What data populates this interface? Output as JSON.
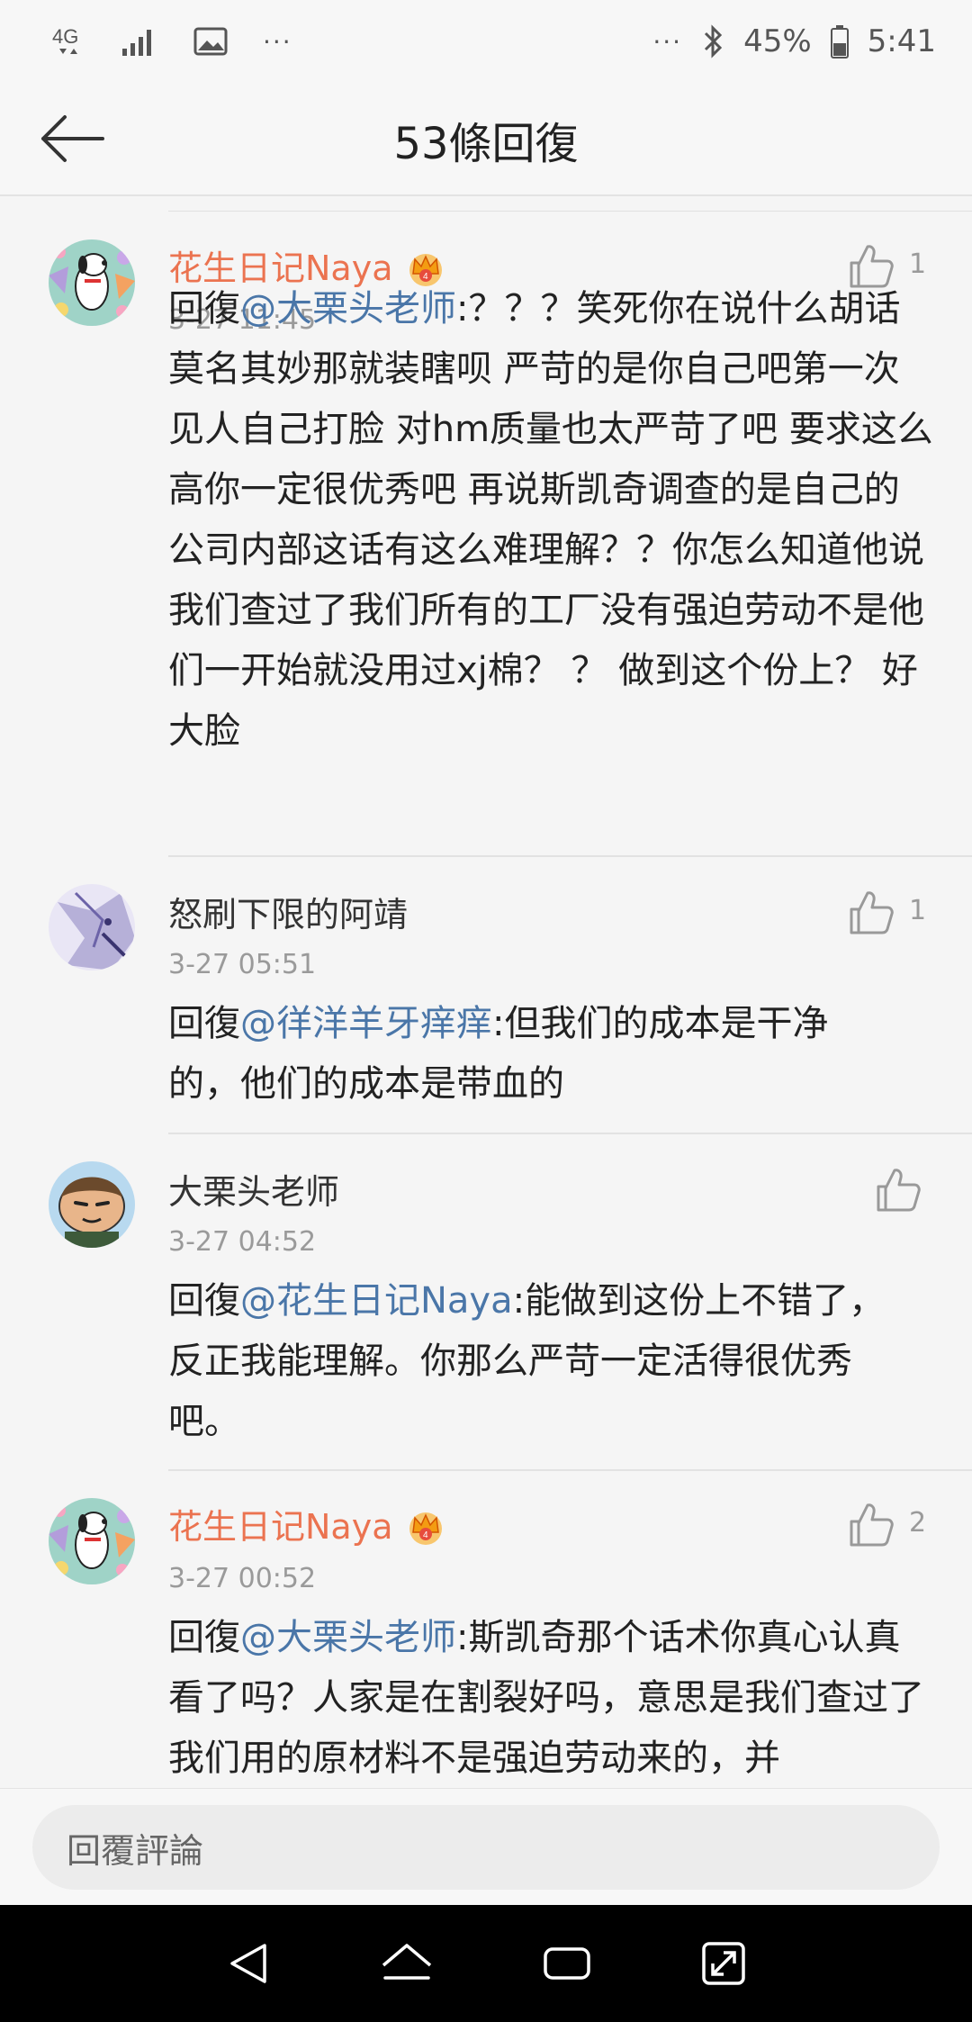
{
  "statusbar": {
    "network": "4G",
    "dots_left": "···",
    "dots_right": "···",
    "battery": "45%",
    "time": "5:41"
  },
  "header": {
    "title": "53條回復"
  },
  "comments": [
    {
      "username": "花生日记Naya",
      "vip": true,
      "time": "3-27 11:45",
      "likes": "1",
      "reply_prefix": "回復",
      "mention": "@大栗头老师",
      "body": ":？？？笑死你在说什么胡话莫名其妙那就装瞎呗 严苛的是你自己吧第一次见人自己打脸 对hm质量也太严苛了吧 要求这么高你一定很优秀吧 再说斯凯奇调查的是自己的公司内部这话有这么难理解？？你怎么知道他说我们查过了我们所有的工厂没有强迫劳动不是他们一开始就没用过xj棉？ ？ 做到这个份上？ 好大脸"
    },
    {
      "username": "怒刷下限的阿靖",
      "vip": false,
      "time": "3-27 05:51",
      "likes": "1",
      "reply_prefix": "回復",
      "mention": "@徉洋羊牙痒痒",
      "body": ":但我们的成本是干净的，他们的成本是带血的"
    },
    {
      "username": "大栗头老师",
      "vip": false,
      "time": "3-27 04:52",
      "likes": "",
      "reply_prefix": "回復",
      "mention": "@花生日记Naya",
      "body": ":能做到这份上不错了，反正我能理解。你那么严苛一定活得很优秀吧。"
    },
    {
      "username": "花生日记Naya",
      "vip": true,
      "time": "3-27 00:52",
      "likes": "2",
      "reply_prefix": "回復",
      "mention": "@大栗头老师",
      "body": ":斯凯奇那个话术你真心认真看了吗？人家是在割裂好吗，意思是我们查过了我们用的原材料不是强迫劳动来的，并"
    }
  ],
  "reply_bar": {
    "placeholder": "回覆評論"
  },
  "colors": {
    "vip_name": "#eb7350",
    "mention": "#4a76a8"
  }
}
